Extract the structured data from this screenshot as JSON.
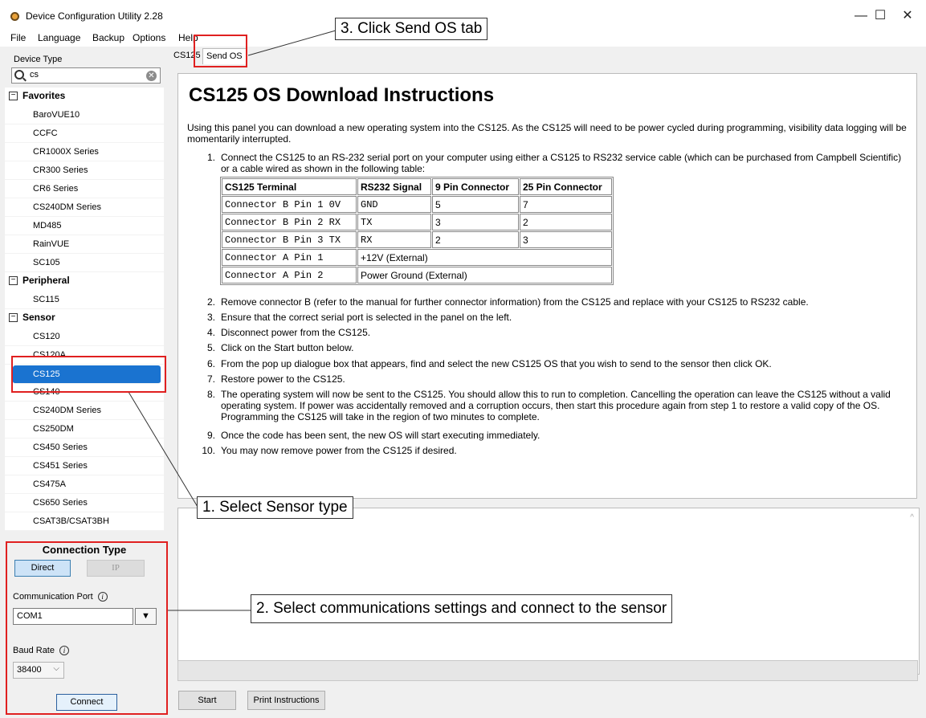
{
  "window": {
    "title": "Device Configuration Utility 2.28",
    "minimize": "—",
    "maximize": "☐",
    "close": "✕"
  },
  "menu": [
    "File",
    "Language",
    "Backup",
    "Options",
    "Help"
  ],
  "sidebar": {
    "device_type_label": "Device Type",
    "search_value": "cs",
    "groups": [
      {
        "label": "Favorites",
        "items": [
          "BaroVUE10",
          "CCFC",
          "CR1000X Series",
          "CR300 Series",
          "CR6 Series",
          "CS240DM Series",
          "MD485",
          "RainVUE",
          "SC105"
        ]
      },
      {
        "label": "Peripheral",
        "items": [
          "SC115"
        ]
      },
      {
        "label": "Sensor",
        "items": [
          "CS120",
          "CS120A",
          "CS125",
          "CS140",
          "CS240DM Series",
          "CS250DM",
          "CS450 Series",
          "CS451 Series",
          "CS475A",
          "CS650 Series",
          "CSAT3B/CSAT3BH"
        ]
      }
    ],
    "selected_item": "CS125"
  },
  "connection": {
    "title": "Connection Type",
    "direct_label": "Direct",
    "ip_label": "IP",
    "port_label": "Communication Port",
    "port_value": "COM1",
    "baud_label": "Baud Rate",
    "baud_value": "38400",
    "connect_label": "Connect"
  },
  "tabs": [
    "CS125",
    "Send OS"
  ],
  "active_tab": "Send OS",
  "doc": {
    "title": "CS125 OS Download Instructions",
    "intro": "Using this panel you can download a new operating system into the CS125. As the CS125 will need to be power cycled during programming, visibility data logging will be momentarily interrupted.",
    "steps": [
      {
        "num": "1.",
        "text": "Connect the CS125 to an RS-232 serial port on your computer using either a CS125 to RS232 service cable (which can be purchased from Campbell Scientific) or a cable wired as shown in the following table:"
      },
      {
        "num": "2.",
        "text": "Remove connector B (refer to the manual for further connector information) from the CS125 and replace with your CS125 to RS232 cable."
      },
      {
        "num": "3.",
        "text": "Ensure that the correct serial port is selected in the panel on the left."
      },
      {
        "num": "4.",
        "text": "Disconnect power from the CS125."
      },
      {
        "num": "5.",
        "text": "Click on the Start button below."
      },
      {
        "num": "6.",
        "text": "From the pop up dialogue box that appears, find and select the new CS125 OS that you wish to send to the sensor then click OK."
      },
      {
        "num": "7.",
        "text": "Restore power to the CS125."
      },
      {
        "num": "8.",
        "text": "The operating system will now be sent to the CS125. You should allow this to run to completion. Cancelling the operation can leave the CS125 without a valid operating system. If power was accidentally removed and a corruption occurs, then start this procedure again from step 1 to restore a valid copy of the OS. Programming the CS125 will take in the region of two minutes to complete."
      },
      {
        "num": "9.",
        "text": "Once the code has been sent, the new OS will start executing immediately."
      },
      {
        "num": "10.",
        "text": "You may now remove power from the CS125 if desired."
      }
    ],
    "table": {
      "headers": [
        "CS125 Terminal",
        "RS232 Signal",
        "9 Pin Connector",
        "25 Pin Connector"
      ],
      "rows": [
        [
          "Connector B Pin 1 0V",
          "GND",
          "5",
          "7"
        ],
        [
          "Connector B Pin 2 RX",
          "TX",
          "3",
          "2"
        ],
        [
          "Connector B Pin 3 TX",
          "RX",
          "2",
          "3"
        ],
        [
          "Connector A Pin 1",
          "+12V (External)"
        ],
        [
          "Connector A Pin 2",
          "Power Ground (External)"
        ]
      ]
    }
  },
  "buttons": {
    "start": "Start",
    "print": "Print Instructions"
  },
  "annotations": {
    "callout_1": "1. Select Sensor type",
    "callout_2": "2. Select communications settings and connect to the sensor",
    "callout_3": "3. Click Send OS tab",
    "highlight_color": "#e02020"
  }
}
